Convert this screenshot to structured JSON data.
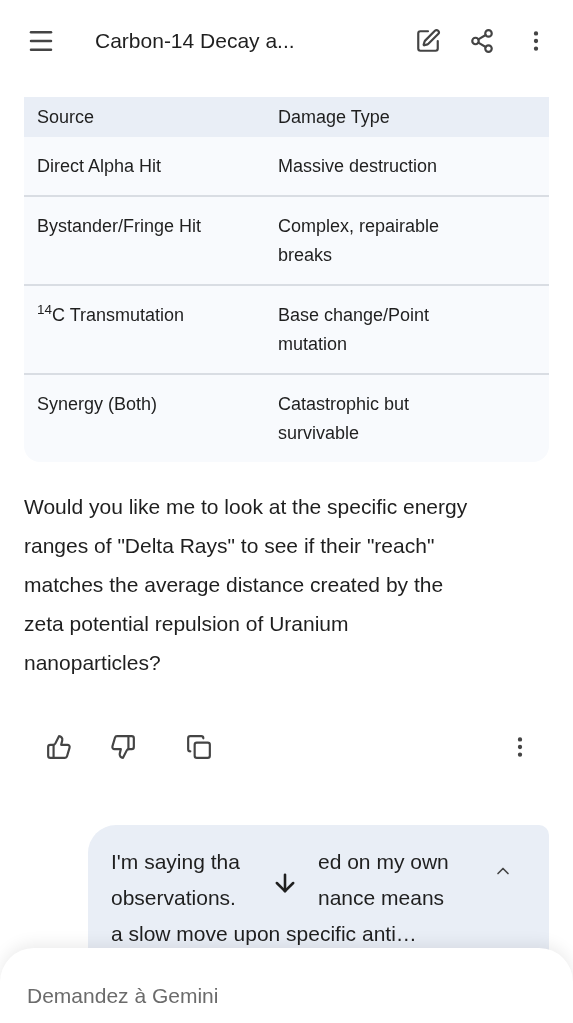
{
  "header": {
    "title": "Carbon-14 Decay a..."
  },
  "table": {
    "columns": [
      "Source",
      "Damage Type"
    ],
    "rows": [
      [
        "Direct Alpha Hit",
        "Massive destruction"
      ],
      [
        "Bystander/Fringe Hit",
        "Complex, repairable breaks"
      ],
      [
        "$^{14}$C Transmutation",
        "Base change/Point mutation"
      ],
      [
        "Synergy (Both)",
        "Catastrophic but survivable"
      ]
    ]
  },
  "response": "Would you like me to look at the specific energy ranges of \"Delta Rays\" to see if their \"reach\" matches the average distance created by the zeta potential repulsion of Uranium nanoparticles?",
  "user_message": {
    "lines": [
      [
        "I'm saying tha",
        "ed on my own"
      ],
      [
        "observations.",
        "nance means"
      ],
      [
        "a slow move upon specific anti…"
      ]
    ],
    "expanded": false
  },
  "input": {
    "placeholder": "Demandez à Gemini"
  }
}
